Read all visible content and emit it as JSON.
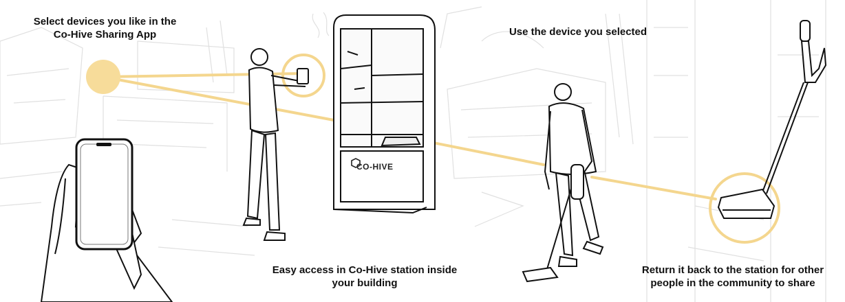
{
  "colors": {
    "accent": "#f7dc9a",
    "accent_line": "#f4d68e",
    "ink": "#111111",
    "sketch": "#dddddd"
  },
  "captions": {
    "step1_line1": "Select devices you like in the",
    "step1_line2": "Co-Hive Sharing App",
    "step2": "Use the device you selected",
    "step3_line1": "Easy access in Co-Hive station inside",
    "step3_line2": "your building",
    "step4_line1": "Return it back to the station for other",
    "step4_line2": "people in the community to share"
  },
  "station": {
    "brand": "CO-HIVE"
  },
  "icons": {
    "station_logo": "co-hive-hexagon-logo",
    "phone": "smartphone-icon",
    "vacuum": "stick-vacuum-icon"
  }
}
